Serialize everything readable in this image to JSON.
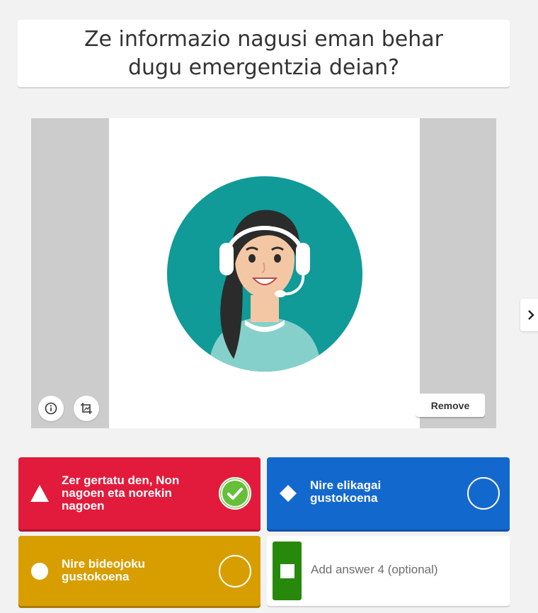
{
  "question": {
    "line1": "Ze informazio nagusi eman behar",
    "line2": "dugu emergentzia deian?"
  },
  "media": {
    "image_subject": "call-center-operator-illustration",
    "remove_label": "Remove",
    "info_icon": "info-icon",
    "crop_icon": "crop-icon"
  },
  "navigation": {
    "next_icon": "chevron-right-icon"
  },
  "answers": [
    {
      "line1": "Zer gertatu den, Non",
      "line2": "nagoen eta norekin",
      "line3": "nagoen",
      "color": "#e21b3c",
      "shape": "triangle",
      "correct": true
    },
    {
      "line1": "Nire elikagai",
      "line2": "gustokoena",
      "color": "#1368ce",
      "shape": "diamond",
      "correct": false
    },
    {
      "line1": "Nire bideojoku",
      "line2": "gustokoena",
      "color": "#d89e00",
      "shape": "circle",
      "correct": false
    },
    {
      "placeholder": "Add answer 4 (optional)",
      "color": "#26890c",
      "shape": "square",
      "correct": false
    }
  ]
}
